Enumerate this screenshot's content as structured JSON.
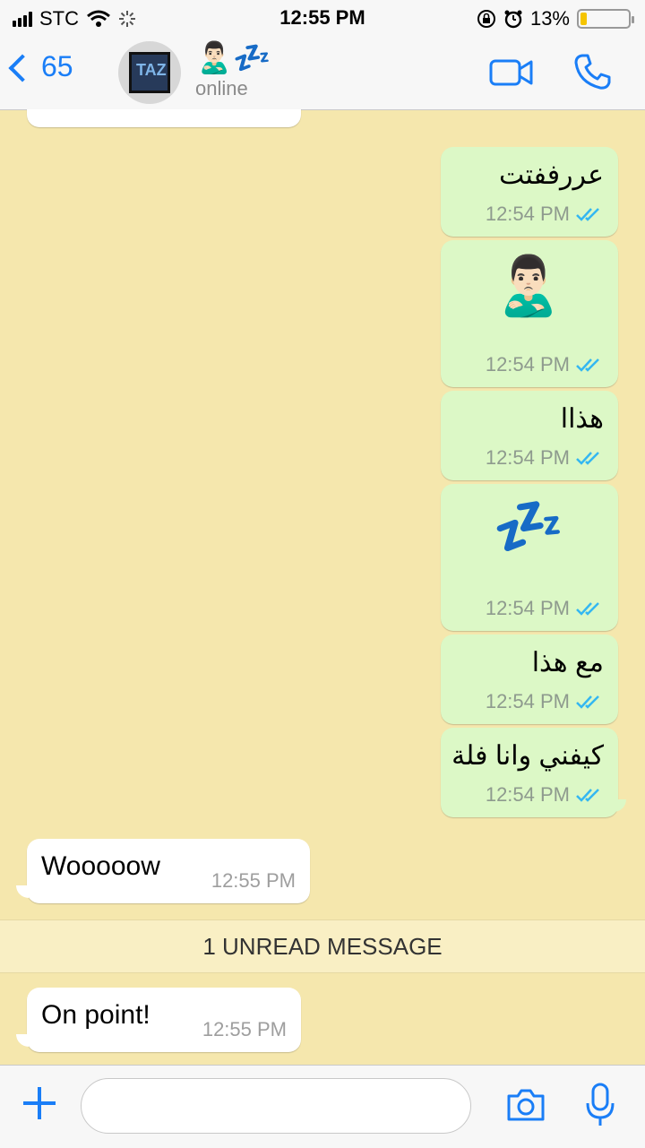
{
  "status_bar": {
    "carrier": "STC",
    "time": "12:55 PM",
    "battery": "13%",
    "battery_level": 0.13
  },
  "header": {
    "back_count": "65",
    "avatar_text": "TAZ",
    "contact_name": "🙎🏻‍♂️💤",
    "contact_status": "online"
  },
  "messages": [
    {
      "direction": "out",
      "text": "عررففتت",
      "time": "12:54 PM"
    },
    {
      "direction": "out",
      "text": "🙎🏻‍♂️",
      "time": "12:54 PM"
    },
    {
      "direction": "out",
      "text": "هذاا",
      "time": "12:54 PM"
    },
    {
      "direction": "out",
      "text": "💤",
      "time": "12:54 PM"
    },
    {
      "direction": "out",
      "text": "مع هذا",
      "time": "12:54 PM"
    },
    {
      "direction": "out",
      "text": "كيفني وانا فلة",
      "time": "12:54 PM"
    },
    {
      "direction": "in",
      "text": "Wooooow",
      "time": "12:55 PM"
    },
    {
      "direction": "in",
      "text": "On point!",
      "time": "12:55 PM"
    }
  ],
  "unread_banner": "1 UNREAD MESSAGE",
  "composer": {
    "placeholder": ""
  },
  "colors": {
    "accent": "#1a7ef7",
    "outgoing_bubble": "#dcf8c6",
    "incoming_bubble": "#ffffff",
    "chat_background": "#f5e7ad"
  }
}
